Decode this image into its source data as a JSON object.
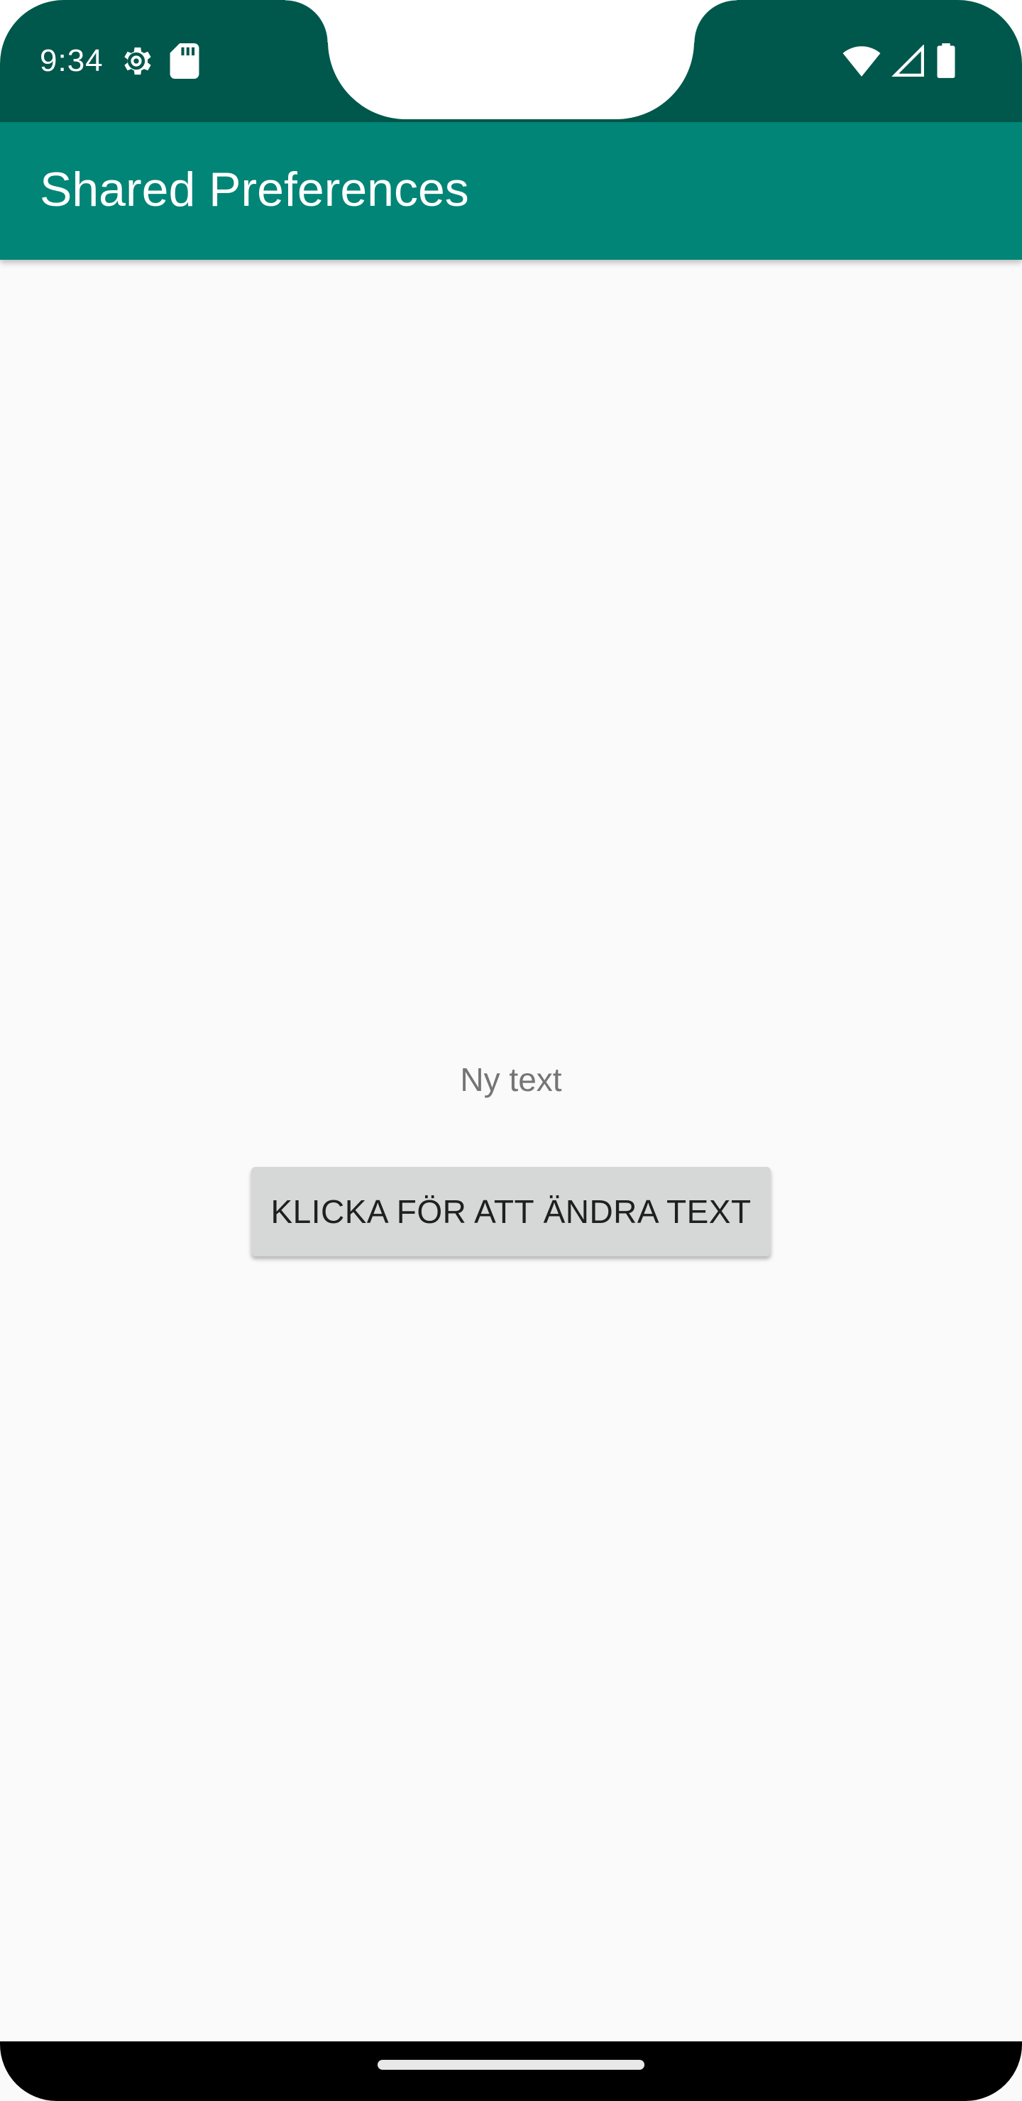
{
  "status_bar": {
    "time": "9:34",
    "left_icons": [
      "settings-gear-icon",
      "sd-card-icon"
    ],
    "right_icons": [
      "wifi-icon",
      "cellular-signal-icon",
      "battery-icon"
    ],
    "background_color": "#00574b"
  },
  "app_bar": {
    "title": "Shared Preferences",
    "background_color": "#008577"
  },
  "main": {
    "label": "Ny text",
    "button_label": "KLICKA FÖR ATT ÄNDRA TEXT"
  },
  "navigation_bar": {
    "handle": "home-gesture-handle"
  }
}
